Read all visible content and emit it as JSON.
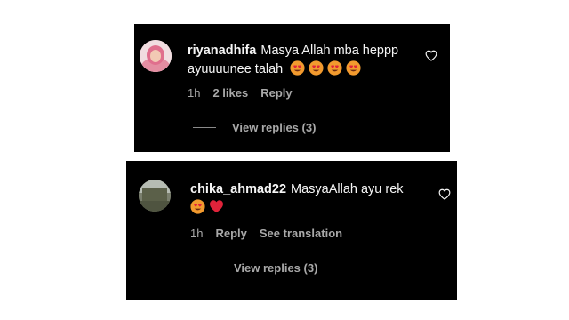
{
  "comments": [
    {
      "username": "riyanadhifa",
      "text": "Masya Allah mba heppp ayuuuunee talah",
      "emojis": [
        "heart-eyes",
        "heart-eyes",
        "heart-eyes",
        "heart-eyes"
      ],
      "time": "1h",
      "likes": "2 likes",
      "reply_label": "Reply",
      "view_replies": "View replies (3)"
    },
    {
      "username": "chika_ahmad22",
      "text": "MasyaAllah ayu rek",
      "emojis": [
        "heart-eyes",
        "red-heart"
      ],
      "time": "1h",
      "reply_label": "Reply",
      "translation_label": "See translation",
      "view_replies": "View replies (3)"
    }
  ],
  "colors": {
    "card_bg": "#000000",
    "text": "#f5f5f5",
    "muted": "#a8a8a8",
    "heart": "#e0233a",
    "emoji_face": "#f29a2e"
  }
}
